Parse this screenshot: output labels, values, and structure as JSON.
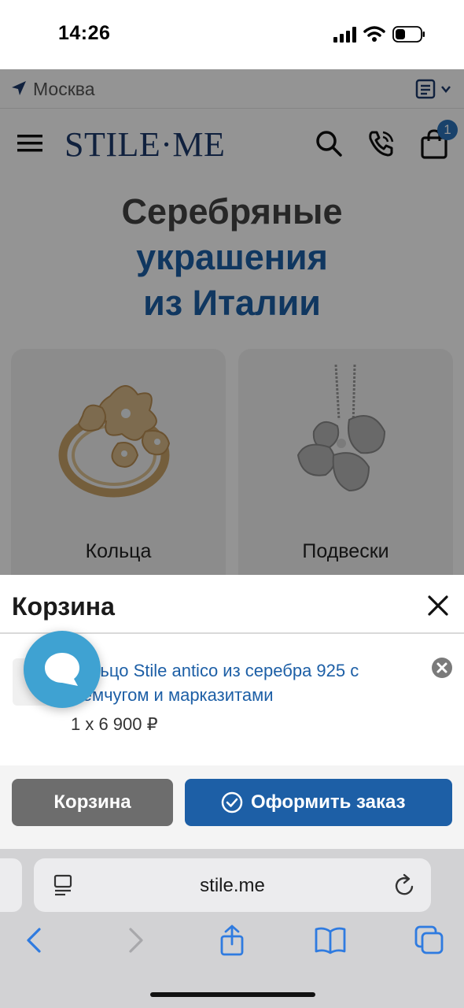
{
  "status_bar": {
    "time": "14:26",
    "icons": [
      "cellular-signal-icon",
      "wifi-icon",
      "battery-icon"
    ]
  },
  "location_bar": {
    "city": "Москва",
    "icons": [
      "location-arrow-icon",
      "document-list-icon",
      "chevron-down-icon"
    ]
  },
  "header": {
    "logo": "STILE·ME",
    "cart_count": "1",
    "icons": [
      "menu-icon",
      "search-icon",
      "phone-icon",
      "shopping-bag-icon"
    ]
  },
  "hero": {
    "line1": "Серебряные",
    "line2": "украшения",
    "line3": "из Италии"
  },
  "categories": [
    {
      "label": "Кольца",
      "image": "ring-image"
    },
    {
      "label": "Подвески",
      "image": "pendant-image"
    }
  ],
  "cart_sheet": {
    "title": "Корзина",
    "item": {
      "name": "Кольцо Stile antico из серебра 925 с жемчугом и марказитами",
      "qty_price": "1 х 6 900 ₽"
    },
    "cart_button": "Корзина",
    "checkout_button": "Оформить заказ"
  },
  "browser": {
    "url": "stile.me",
    "icons": [
      "reader-icon",
      "reload-icon",
      "back-icon",
      "forward-icon",
      "share-icon",
      "bookmarks-icon",
      "tabs-icon"
    ]
  },
  "colors": {
    "brand_blue": "#1d5fa6",
    "chat_blue": "#3fa2d2",
    "button_gray": "#6d6d6d"
  }
}
